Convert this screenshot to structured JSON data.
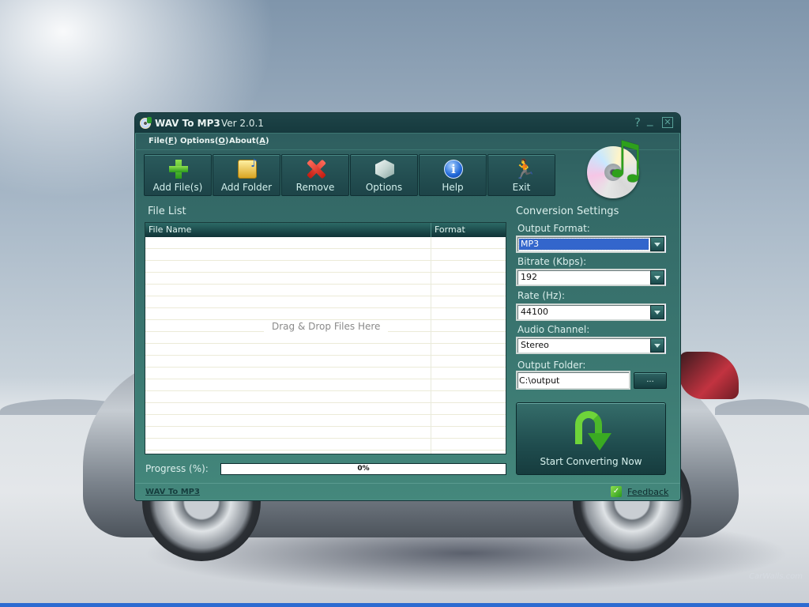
{
  "desktop": {
    "watermark": "CarWalls.com"
  },
  "window": {
    "title": "WAV To MP3",
    "version": "Ver 2.0.1",
    "controls": {
      "help": "?",
      "minimize": "_",
      "close": "✕"
    }
  },
  "menu": [
    {
      "label": "File",
      "accel": "F"
    },
    {
      "label": "Options",
      "accel": "O"
    },
    {
      "label": "About",
      "accel": "A"
    }
  ],
  "toolbar": [
    {
      "label": "Add File(s)",
      "icon": "plus-icon"
    },
    {
      "label": "Add Folder",
      "icon": "folder-icon"
    },
    {
      "label": "Remove",
      "icon": "x-icon"
    },
    {
      "label": "Options",
      "icon": "cube-icon"
    },
    {
      "label": "Help",
      "icon": "info-icon",
      "glyph": "i"
    },
    {
      "label": "Exit",
      "icon": "running-man-icon",
      "glyph": "🏃"
    }
  ],
  "file_list": {
    "title": "File List",
    "columns": [
      "File Name",
      "Format"
    ],
    "rows": [],
    "placeholder": "Drag & Drop Files Here"
  },
  "progress": {
    "label": "Progress (%):",
    "value_percent": 0,
    "text": "0%"
  },
  "settings": {
    "title": "Conversion Settings",
    "output_format": {
      "label": "Output Format:",
      "value": "MP3"
    },
    "bitrate": {
      "label": "Bitrate (Kbps):",
      "value": "192"
    },
    "rate": {
      "label": "Rate (Hz):",
      "value": "44100"
    },
    "channel": {
      "label": "Audio Channel:",
      "value": "Stereo"
    },
    "output_folder": {
      "label": "Output Folder:",
      "value": "C:\\output",
      "browse_label": "..."
    },
    "convert_label": "Start Converting Now"
  },
  "statusbar": {
    "app_link": "WAV To MP3",
    "feedback": "Feedback",
    "feedback_glyph": "✓"
  }
}
